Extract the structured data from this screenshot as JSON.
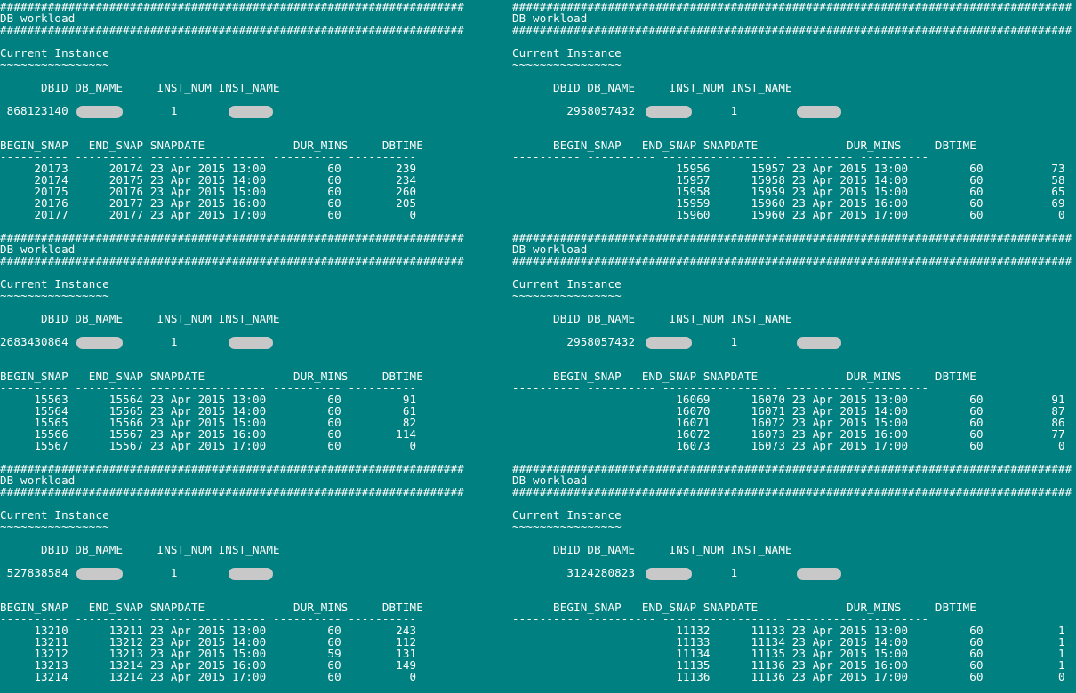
{
  "header": {
    "hash_rule_left": "####################################################################",
    "hash_rule_right": "##################################################################################",
    "title": "DB workload",
    "instance_label": "Current Instance",
    "instance_tilde": "~~~~~~~~~~~~~~~~",
    "db_cols": "      DBID DB_NAME     INST_NUM INST_NAME",
    "db_dash": "---------- --------- ---------- ----------------",
    "snap_cols_left": "BEGIN_SNAP   END_SNAP SNAPDATE             DUR_MINS     DBTIME",
    "snap_cols_right": "      BEGIN_SNAP   END_SNAP SNAPDATE             DUR_MINS     DBTIME",
    "snap_dash_left": "---------- ---------- ----------------- ---------- ----------",
    "snap_dash_right": "---------- ---------- ----------------- ---------- ----------"
  },
  "panels": [
    {
      "dbid_row": " 868123140               1",
      "snap_rows": [
        "     20173      20174 23 Apr 2015 13:00         60        239",
        "     20174      20175 23 Apr 2015 14:00         60        234",
        "     20175      20176 23 Apr 2015 15:00         60        260",
        "     20176      20177 23 Apr 2015 16:00         60        205",
        "     20177      20177 23 Apr 2015 17:00         60          0"
      ]
    },
    {
      "dbid_row": "        2958057432              1",
      "snap_rows": [
        "                        15956      15957 23 Apr 2015 13:00         60          73",
        "                        15957      15958 23 Apr 2015 14:00         60          58",
        "                        15958      15959 23 Apr 2015 15:00         60          65",
        "                        15959      15960 23 Apr 2015 16:00         60          69",
        "                        15960      15960 23 Apr 2015 17:00         60           0"
      ]
    },
    {
      "dbid_row": "2683430864               1",
      "snap_rows": [
        "     15563      15564 23 Apr 2015 13:00         60         91",
        "     15564      15565 23 Apr 2015 14:00         60         61",
        "     15565      15566 23 Apr 2015 15:00         60         82",
        "     15566      15567 23 Apr 2015 16:00         60        114",
        "     15567      15567 23 Apr 2015 17:00         60          0"
      ]
    },
    {
      "dbid_row": "        2958057432              1",
      "snap_rows": [
        "                        16069      16070 23 Apr 2015 13:00         60          91",
        "                        16070      16071 23 Apr 2015 14:00         60          87",
        "                        16071      16072 23 Apr 2015 15:00         60          86",
        "                        16072      16073 23 Apr 2015 16:00         60          77",
        "                        16073      16073 23 Apr 2015 17:00         60           0"
      ]
    },
    {
      "dbid_row": " 527838584               1",
      "snap_rows": [
        "     13210      13211 23 Apr 2015 13:00         60        243",
        "     13211      13212 23 Apr 2015 14:00         60        112",
        "     13212      13213 23 Apr 2015 15:00         59        131",
        "     13213      13214 23 Apr 2015 16:00         60        149",
        "     13214      13214 23 Apr 2015 17:00         60          0"
      ]
    },
    {
      "dbid_row": "        3124280823              1",
      "snap_rows": [
        "                        11132      11133 23 Apr 2015 13:00         60           1",
        "                        11133      11134 23 Apr 2015 14:00         60           1",
        "                        11134      11135 23 Apr 2015 15:00         60           1",
        "                        11135      11136 23 Apr 2015 16:00         60           1",
        "                        11136      11136 23 Apr 2015 17:00         60           0"
      ]
    }
  ]
}
